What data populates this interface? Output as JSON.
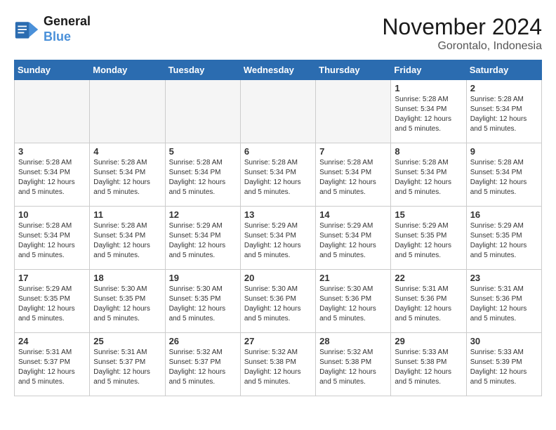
{
  "logo": {
    "line1": "General",
    "line2": "Blue"
  },
  "title": "November 2024",
  "location": "Gorontalo, Indonesia",
  "weekdays": [
    "Sunday",
    "Monday",
    "Tuesday",
    "Wednesday",
    "Thursday",
    "Friday",
    "Saturday"
  ],
  "cells": [
    {
      "day": "",
      "empty": true
    },
    {
      "day": "",
      "empty": true
    },
    {
      "day": "",
      "empty": true
    },
    {
      "day": "",
      "empty": true
    },
    {
      "day": "",
      "empty": true
    },
    {
      "day": "1",
      "sunrise": "5:28 AM",
      "sunset": "5:34 PM",
      "daylight": "12 hours and 5 minutes."
    },
    {
      "day": "2",
      "sunrise": "5:28 AM",
      "sunset": "5:34 PM",
      "daylight": "12 hours and 5 minutes."
    },
    {
      "day": "3",
      "sunrise": "5:28 AM",
      "sunset": "5:34 PM",
      "daylight": "12 hours and 5 minutes."
    },
    {
      "day": "4",
      "sunrise": "5:28 AM",
      "sunset": "5:34 PM",
      "daylight": "12 hours and 5 minutes."
    },
    {
      "day": "5",
      "sunrise": "5:28 AM",
      "sunset": "5:34 PM",
      "daylight": "12 hours and 5 minutes."
    },
    {
      "day": "6",
      "sunrise": "5:28 AM",
      "sunset": "5:34 PM",
      "daylight": "12 hours and 5 minutes."
    },
    {
      "day": "7",
      "sunrise": "5:28 AM",
      "sunset": "5:34 PM",
      "daylight": "12 hours and 5 minutes."
    },
    {
      "day": "8",
      "sunrise": "5:28 AM",
      "sunset": "5:34 PM",
      "daylight": "12 hours and 5 minutes."
    },
    {
      "day": "9",
      "sunrise": "5:28 AM",
      "sunset": "5:34 PM",
      "daylight": "12 hours and 5 minutes."
    },
    {
      "day": "10",
      "sunrise": "5:28 AM",
      "sunset": "5:34 PM",
      "daylight": "12 hours and 5 minutes."
    },
    {
      "day": "11",
      "sunrise": "5:28 AM",
      "sunset": "5:34 PM",
      "daylight": "12 hours and 5 minutes."
    },
    {
      "day": "12",
      "sunrise": "5:29 AM",
      "sunset": "5:34 PM",
      "daylight": "12 hours and 5 minutes."
    },
    {
      "day": "13",
      "sunrise": "5:29 AM",
      "sunset": "5:34 PM",
      "daylight": "12 hours and 5 minutes."
    },
    {
      "day": "14",
      "sunrise": "5:29 AM",
      "sunset": "5:34 PM",
      "daylight": "12 hours and 5 minutes."
    },
    {
      "day": "15",
      "sunrise": "5:29 AM",
      "sunset": "5:35 PM",
      "daylight": "12 hours and 5 minutes."
    },
    {
      "day": "16",
      "sunrise": "5:29 AM",
      "sunset": "5:35 PM",
      "daylight": "12 hours and 5 minutes."
    },
    {
      "day": "17",
      "sunrise": "5:29 AM",
      "sunset": "5:35 PM",
      "daylight": "12 hours and 5 minutes."
    },
    {
      "day": "18",
      "sunrise": "5:30 AM",
      "sunset": "5:35 PM",
      "daylight": "12 hours and 5 minutes."
    },
    {
      "day": "19",
      "sunrise": "5:30 AM",
      "sunset": "5:35 PM",
      "daylight": "12 hours and 5 minutes."
    },
    {
      "day": "20",
      "sunrise": "5:30 AM",
      "sunset": "5:36 PM",
      "daylight": "12 hours and 5 minutes."
    },
    {
      "day": "21",
      "sunrise": "5:30 AM",
      "sunset": "5:36 PM",
      "daylight": "12 hours and 5 minutes."
    },
    {
      "day": "22",
      "sunrise": "5:31 AM",
      "sunset": "5:36 PM",
      "daylight": "12 hours and 5 minutes."
    },
    {
      "day": "23",
      "sunrise": "5:31 AM",
      "sunset": "5:36 PM",
      "daylight": "12 hours and 5 minutes."
    },
    {
      "day": "24",
      "sunrise": "5:31 AM",
      "sunset": "5:37 PM",
      "daylight": "12 hours and 5 minutes."
    },
    {
      "day": "25",
      "sunrise": "5:31 AM",
      "sunset": "5:37 PM",
      "daylight": "12 hours and 5 minutes."
    },
    {
      "day": "26",
      "sunrise": "5:32 AM",
      "sunset": "5:37 PM",
      "daylight": "12 hours and 5 minutes."
    },
    {
      "day": "27",
      "sunrise": "5:32 AM",
      "sunset": "5:38 PM",
      "daylight": "12 hours and 5 minutes."
    },
    {
      "day": "28",
      "sunrise": "5:32 AM",
      "sunset": "5:38 PM",
      "daylight": "12 hours and 5 minutes."
    },
    {
      "day": "29",
      "sunrise": "5:33 AM",
      "sunset": "5:38 PM",
      "daylight": "12 hours and 5 minutes."
    },
    {
      "day": "30",
      "sunrise": "5:33 AM",
      "sunset": "5:39 PM",
      "daylight": "12 hours and 5 minutes."
    }
  ]
}
